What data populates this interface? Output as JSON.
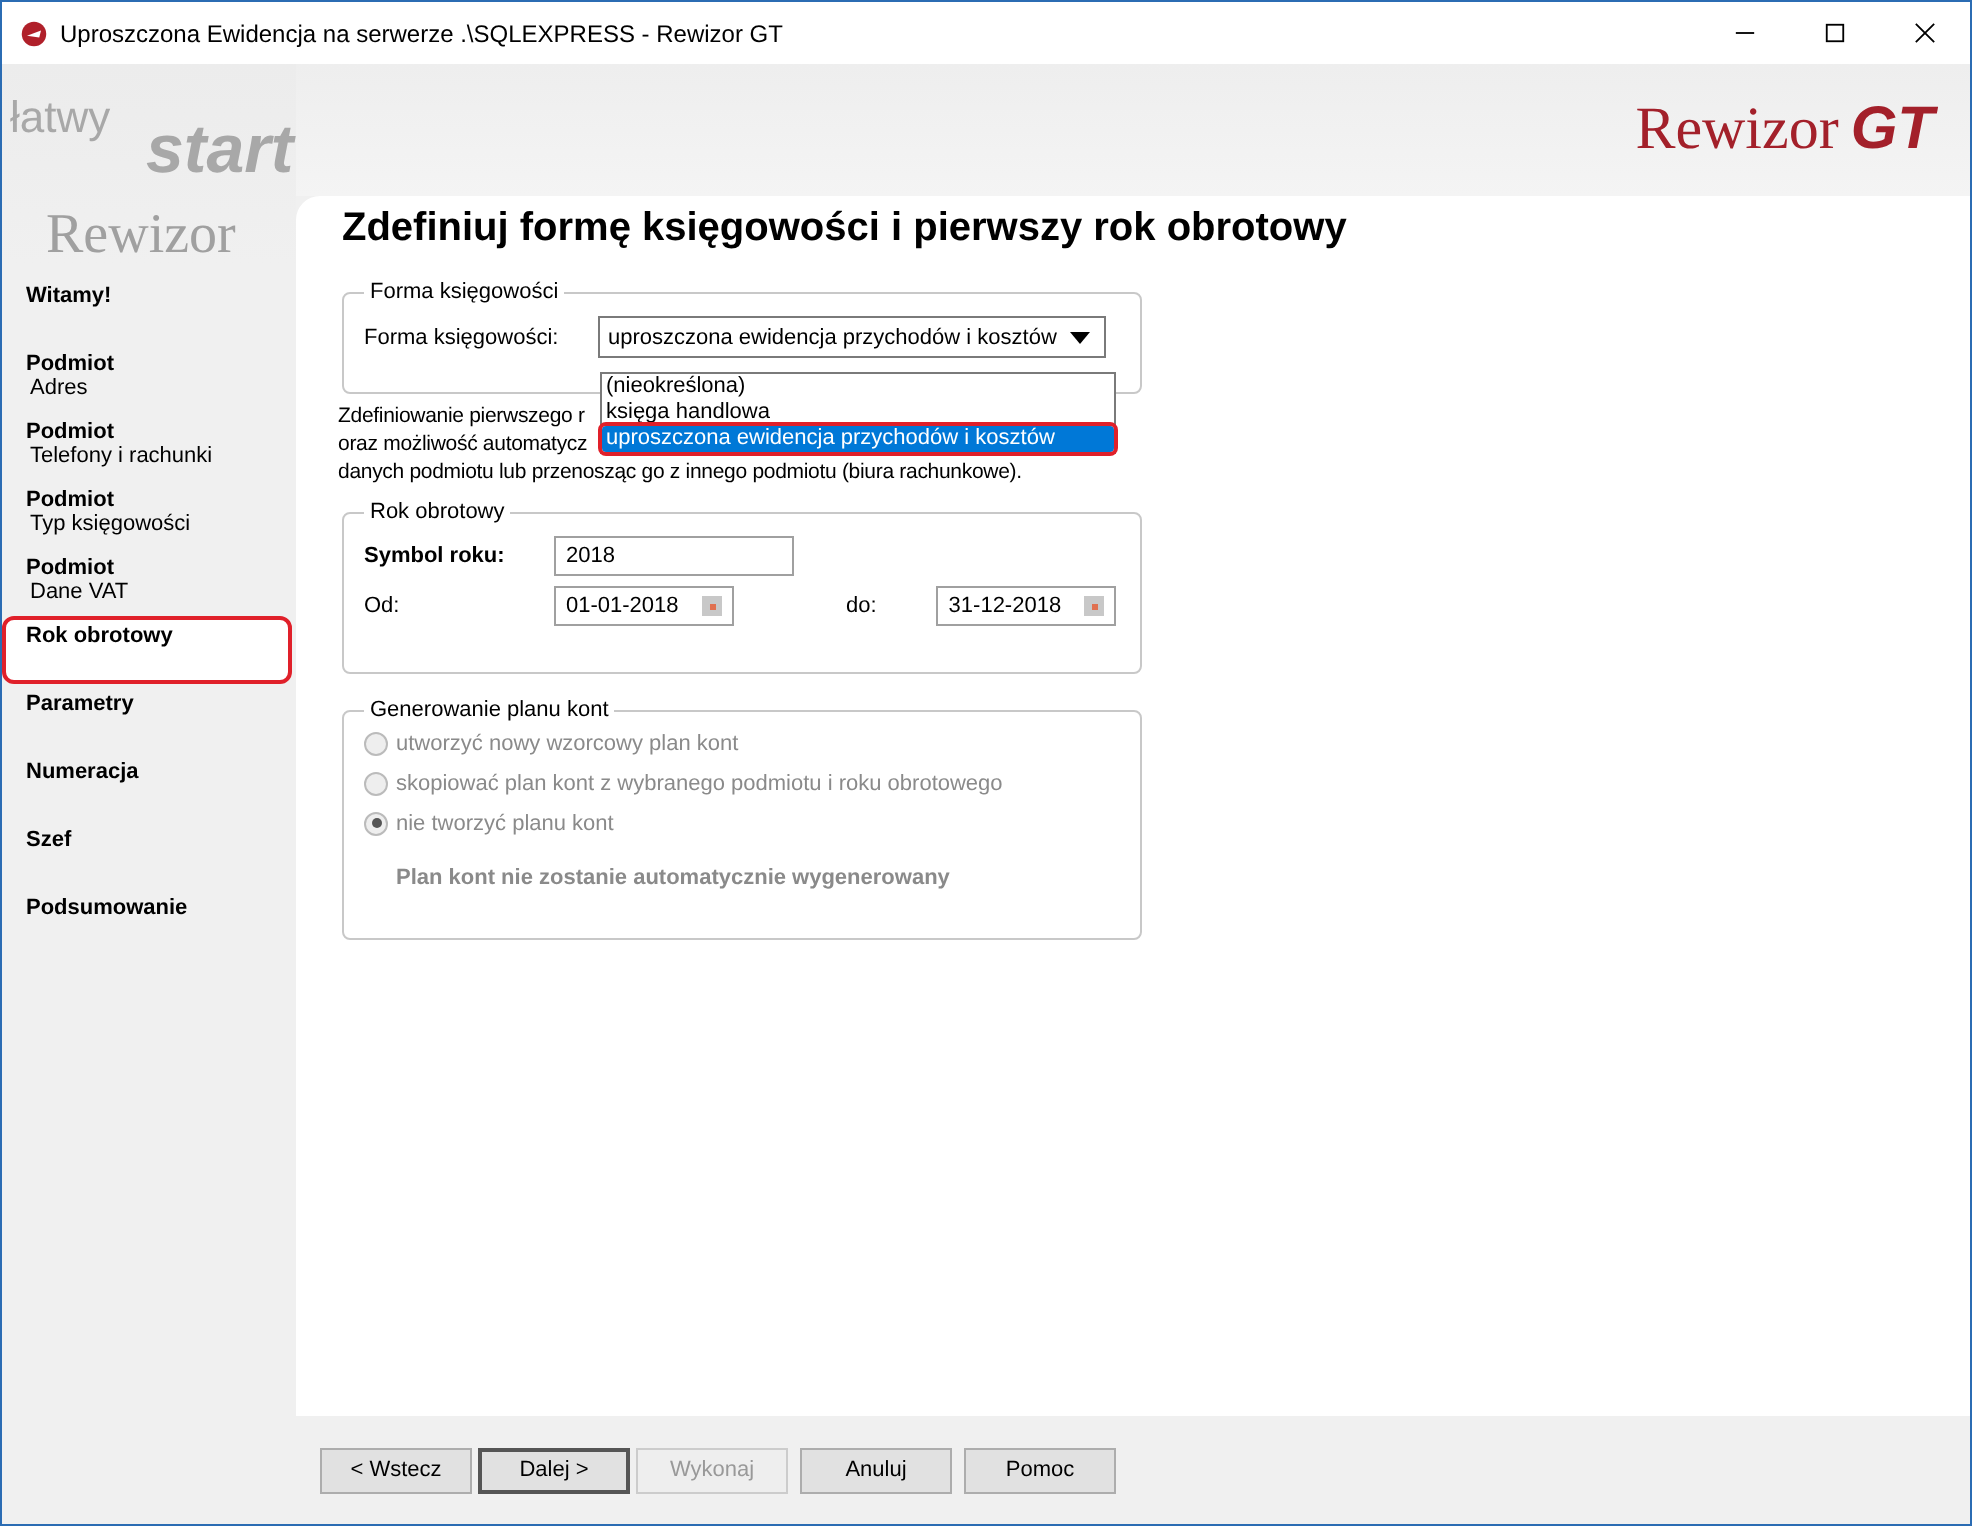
{
  "window": {
    "title": "Uproszczona Ewidencja na serwerze .\\SQLEXPRESS - Rewizor GT"
  },
  "banner": {
    "watermark": [
      "łatwy",
      "start",
      "Rewizor"
    ],
    "logo_word": "Rewizor",
    "logo_mark": "GT"
  },
  "sidebar": {
    "items": [
      {
        "title": "Witamy!",
        "selected": false
      },
      {
        "title": "Podmiot",
        "subtitle": "Adres",
        "selected": false
      },
      {
        "title": "Podmiot",
        "subtitle": "Telefony i rachunki",
        "selected": false
      },
      {
        "title": "Podmiot",
        "subtitle": "Typ księgowości",
        "selected": false
      },
      {
        "title": "Podmiot",
        "subtitle": "Dane VAT",
        "selected": false
      },
      {
        "title": "Rok obrotowy",
        "selected": true
      },
      {
        "title": "Parametry",
        "selected": false
      },
      {
        "title": "Numeracja",
        "selected": false
      },
      {
        "title": "Szef",
        "selected": false
      },
      {
        "title": "Podsumowanie",
        "selected": false
      }
    ]
  },
  "page_title": "Zdefiniuj formę księgowości i pierwszy rok obrotowy",
  "forma": {
    "legend": "Forma księgowości",
    "label": "Forma księgowości:",
    "value": "uproszczona ewidencja przychodów i kosztów",
    "options": [
      {
        "label": "(nieokreślona)",
        "selected": false
      },
      {
        "label": "księga handlowa",
        "selected": false
      },
      {
        "label": "uproszczona ewidencja przychodów i kosztów",
        "selected": true
      }
    ]
  },
  "description": [
    "Zdefiniowanie pierwszego r",
    "oraz możliwość automatycz",
    "danych podmiotu lub przenosząc go z innego podmiotu (biura rachunkowe)."
  ],
  "rok": {
    "legend": "Rok obrotowy",
    "symbol_label": "Symbol roku:",
    "symbol": "2018",
    "from_label": "Od:",
    "from": "01-01-2018",
    "to_label": "do:",
    "to": "31-12-2018"
  },
  "plan": {
    "legend": "Generowanie planu kont",
    "disabled": true,
    "options": [
      {
        "label": "utworzyć nowy wzorcowy plan kont",
        "selected": false
      },
      {
        "label": "skopiować plan kont z wybranego podmiotu i roku obrotowego",
        "selected": false
      },
      {
        "label": "nie tworzyć planu kont",
        "selected": true
      }
    ],
    "note": "Plan kont nie zostanie automatycznie wygenerowany"
  },
  "buttons": [
    {
      "label": "< Wstecz",
      "disabled": false,
      "default": false
    },
    {
      "label": "Dalej >",
      "disabled": false,
      "default": true
    },
    {
      "label": "Wykonaj",
      "disabled": true,
      "default": false
    },
    {
      "label": "Anuluj",
      "disabled": false,
      "default": false
    },
    {
      "label": "Pomoc",
      "disabled": false,
      "default": false
    }
  ]
}
